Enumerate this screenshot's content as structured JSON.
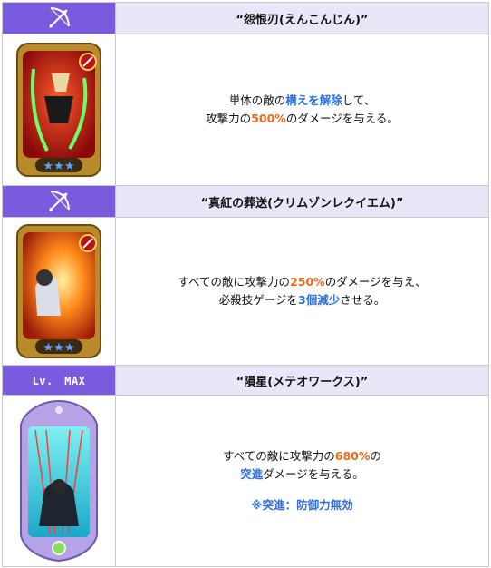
{
  "colors": {
    "header_purple": "#7a5be0",
    "header_light": "#e9e6f7",
    "orange": "#f06a1c",
    "blue": "#2f6fd6"
  },
  "rows": [
    {
      "icon": "bow-arrow-icon",
      "title": "“怨恨刃(えんこんじん)”",
      "desc": {
        "line1_a": "単体の敵の",
        "line1_hl": "構えを解除",
        "line1_b": "して、",
        "line2_a": "攻撃力の",
        "line2_hl": "500%",
        "line2_b": "のダメージを与える。"
      }
    },
    {
      "icon": "bow-arrow-icon",
      "title": "“真紅の葬送(クリムゾンレクイエム)”",
      "desc": {
        "line1_a": "すべての敵に攻撃力の",
        "line1_hl": "250%",
        "line1_b": "のダメージを与え、",
        "line2_a": "必殺技ゲージを",
        "line2_hl": "3個減少",
        "line2_b": "させる。"
      }
    },
    {
      "level_label": "Lv.　MAX",
      "title": "“隕星(メテオワークス)”",
      "desc": {
        "line1_a": "すべての敵に攻撃力の",
        "line1_hl": "680%",
        "line1_b": "の",
        "line2_hl": "突進",
        "line2_b": "ダメージを与える。",
        "note": "※突進：防御力無効"
      }
    }
  ]
}
